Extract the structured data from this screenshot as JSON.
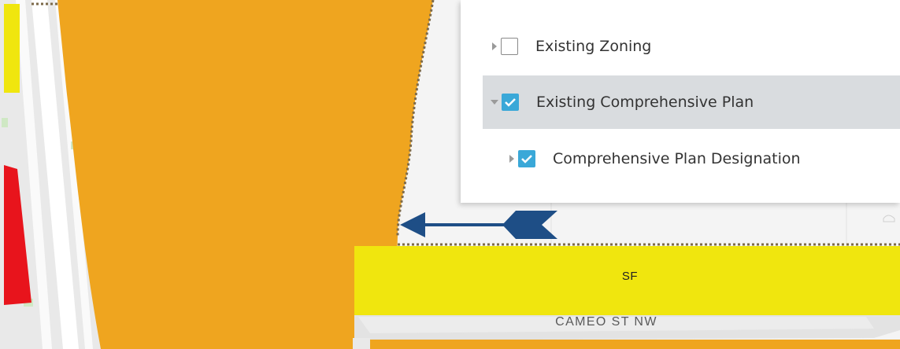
{
  "map": {
    "labels": {
      "parcel_code": "SF",
      "street_name": "CAMEO ST NW"
    },
    "colors": {
      "orange_zone": "#efa51f",
      "yellow_zone": "#f0e60e",
      "red_zone": "#e8141c",
      "road": "#e6e6e6",
      "background": "#f2f2f2",
      "arrow": "#1e4e86"
    },
    "annotation": {
      "type": "arrow",
      "direction": "left",
      "color": "#1e4e86"
    }
  },
  "layer_list": {
    "items": [
      {
        "label": "Existing Zoning",
        "checked": false,
        "expanded": false,
        "selected": false,
        "indent": 0,
        "icon": "caret-right-icon"
      },
      {
        "label": "Existing Comprehensive Plan",
        "checked": true,
        "expanded": true,
        "selected": true,
        "indent": 0,
        "icon": "caret-down-icon"
      },
      {
        "label": "Comprehensive Plan Designation",
        "checked": true,
        "expanded": false,
        "selected": false,
        "indent": 1,
        "icon": "caret-right-icon"
      }
    ]
  }
}
